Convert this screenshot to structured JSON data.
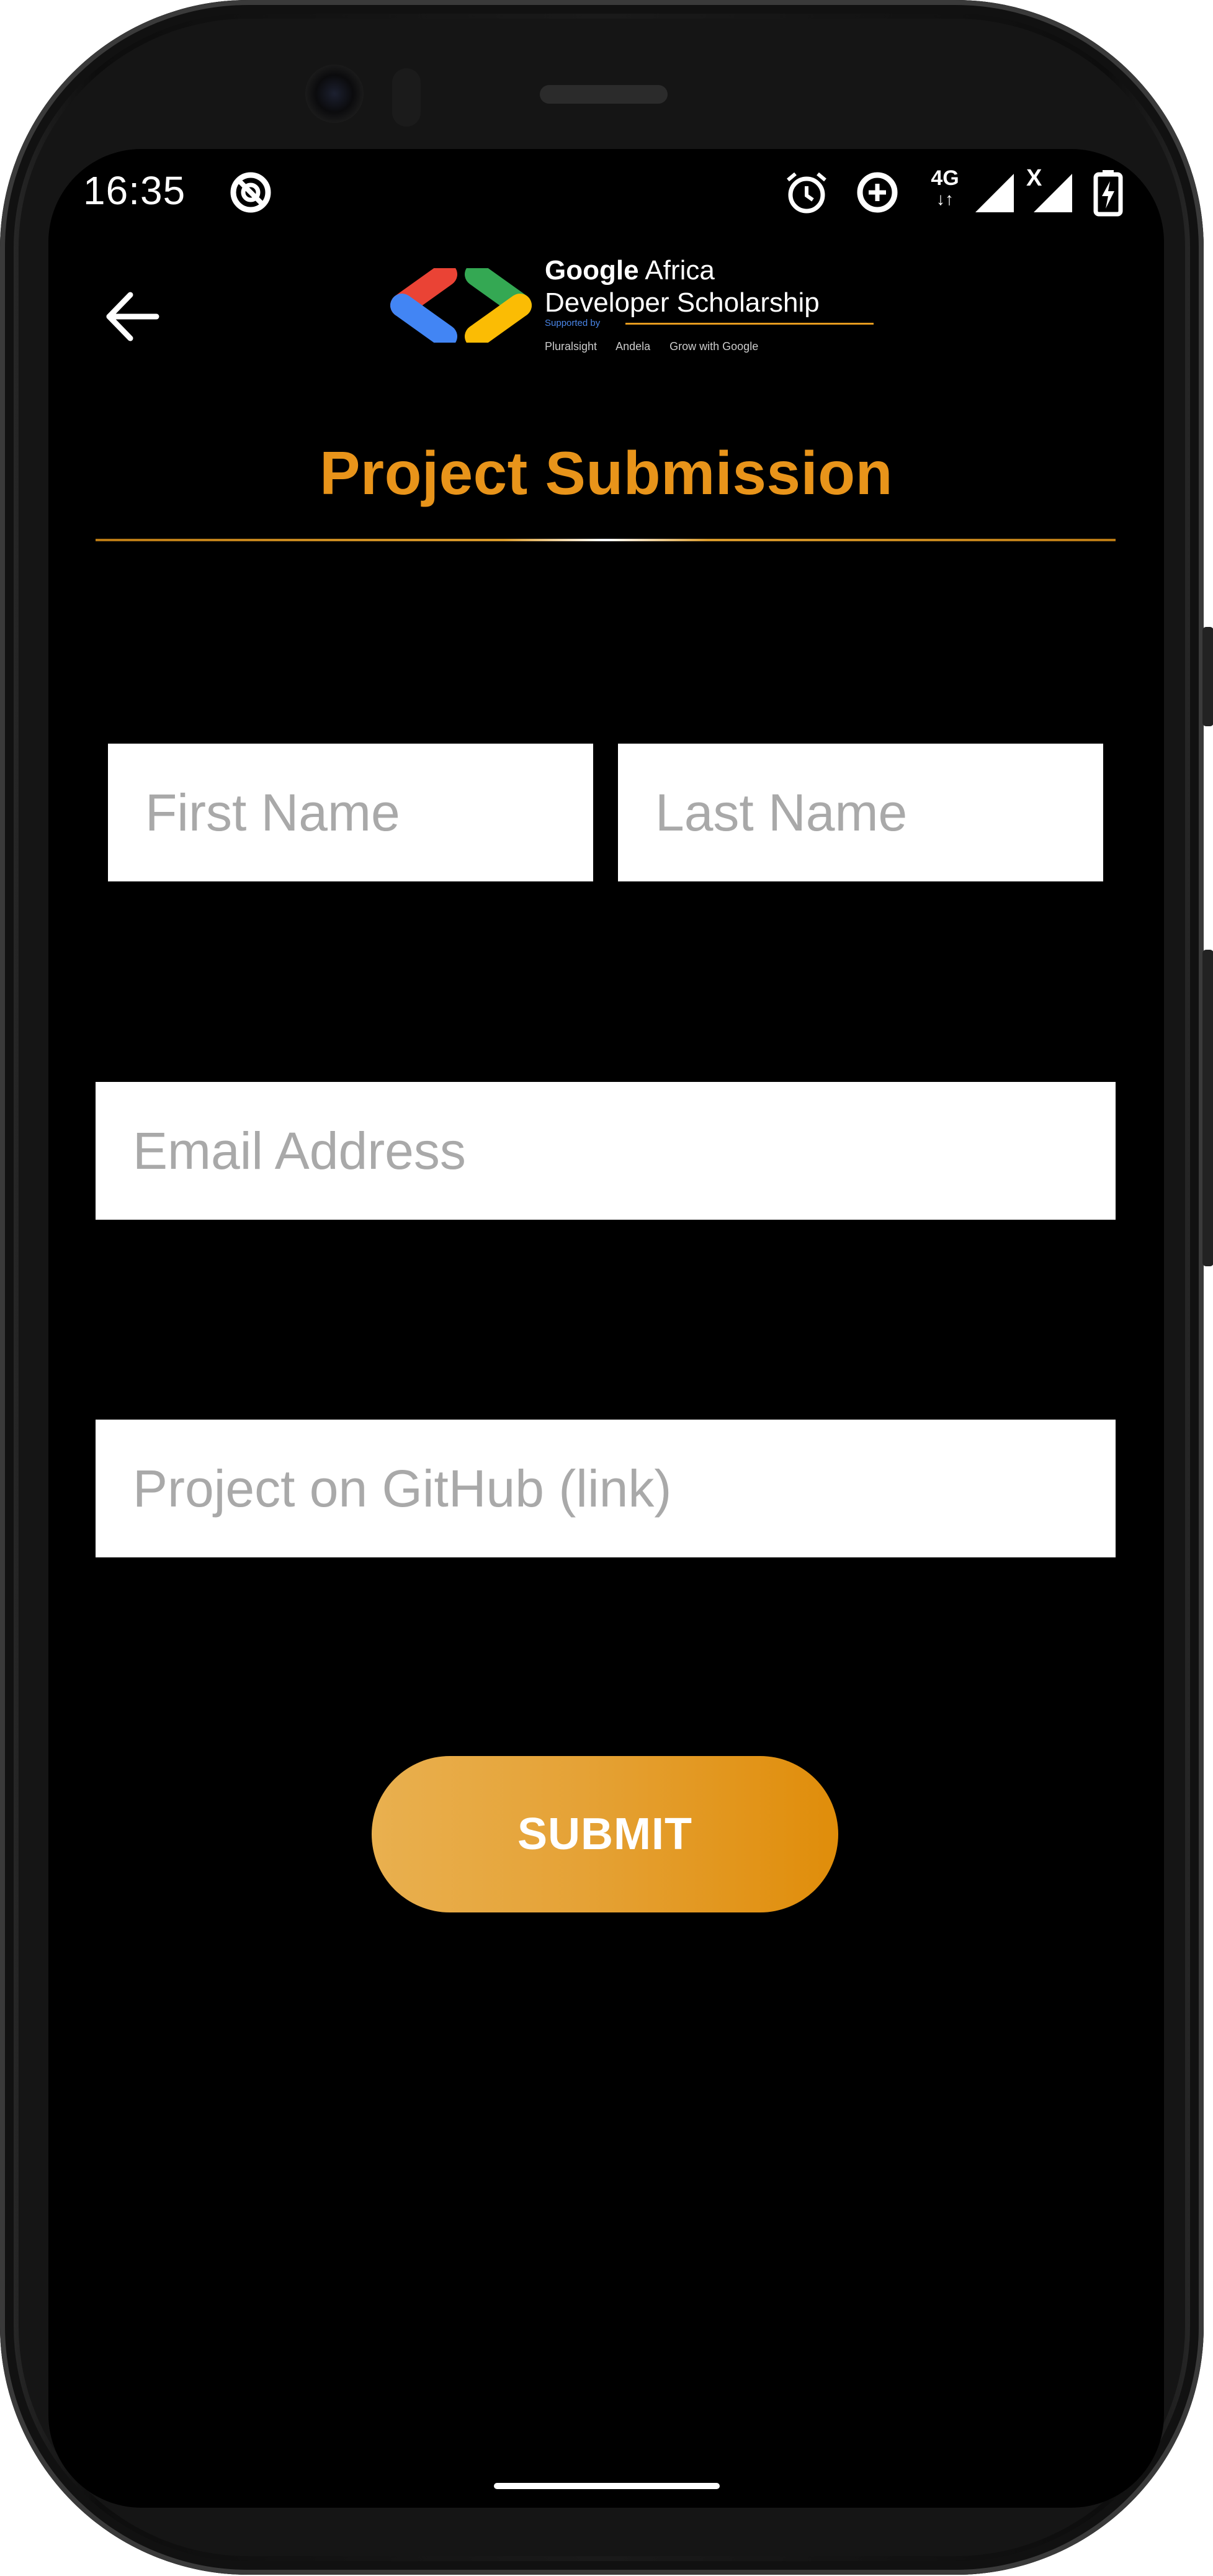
{
  "status_bar": {
    "time": "16:35",
    "network_label": "4G",
    "network_no_signal": "X"
  },
  "app_bar": {
    "logo": {
      "title_bold": "Google",
      "title_rest": " Africa",
      "title_line2": "Developer Scholarship",
      "supported_by": "Supported by",
      "partners": [
        "Pluralsight",
        "Andela",
        "Grow with Google"
      ]
    }
  },
  "page": {
    "title": "Project Submission"
  },
  "form": {
    "first_name_placeholder": "First Name",
    "last_name_placeholder": "Last Name",
    "email_placeholder": "Email Address",
    "github_placeholder": "Project on GitHub (link)",
    "submit_label": "SUBMIT"
  },
  "colors": {
    "accent": "#e8941a",
    "background": "#000000",
    "field_background": "#ffffff",
    "placeholder": "#a9a9a9"
  },
  "icons": {
    "back": "arrow-left-icon",
    "dnd": "do-not-disturb-icon",
    "alarm": "alarm-clock-icon",
    "data_saver": "data-saver-icon",
    "signal": "cell-signal-icon",
    "battery": "battery-charging-icon"
  }
}
